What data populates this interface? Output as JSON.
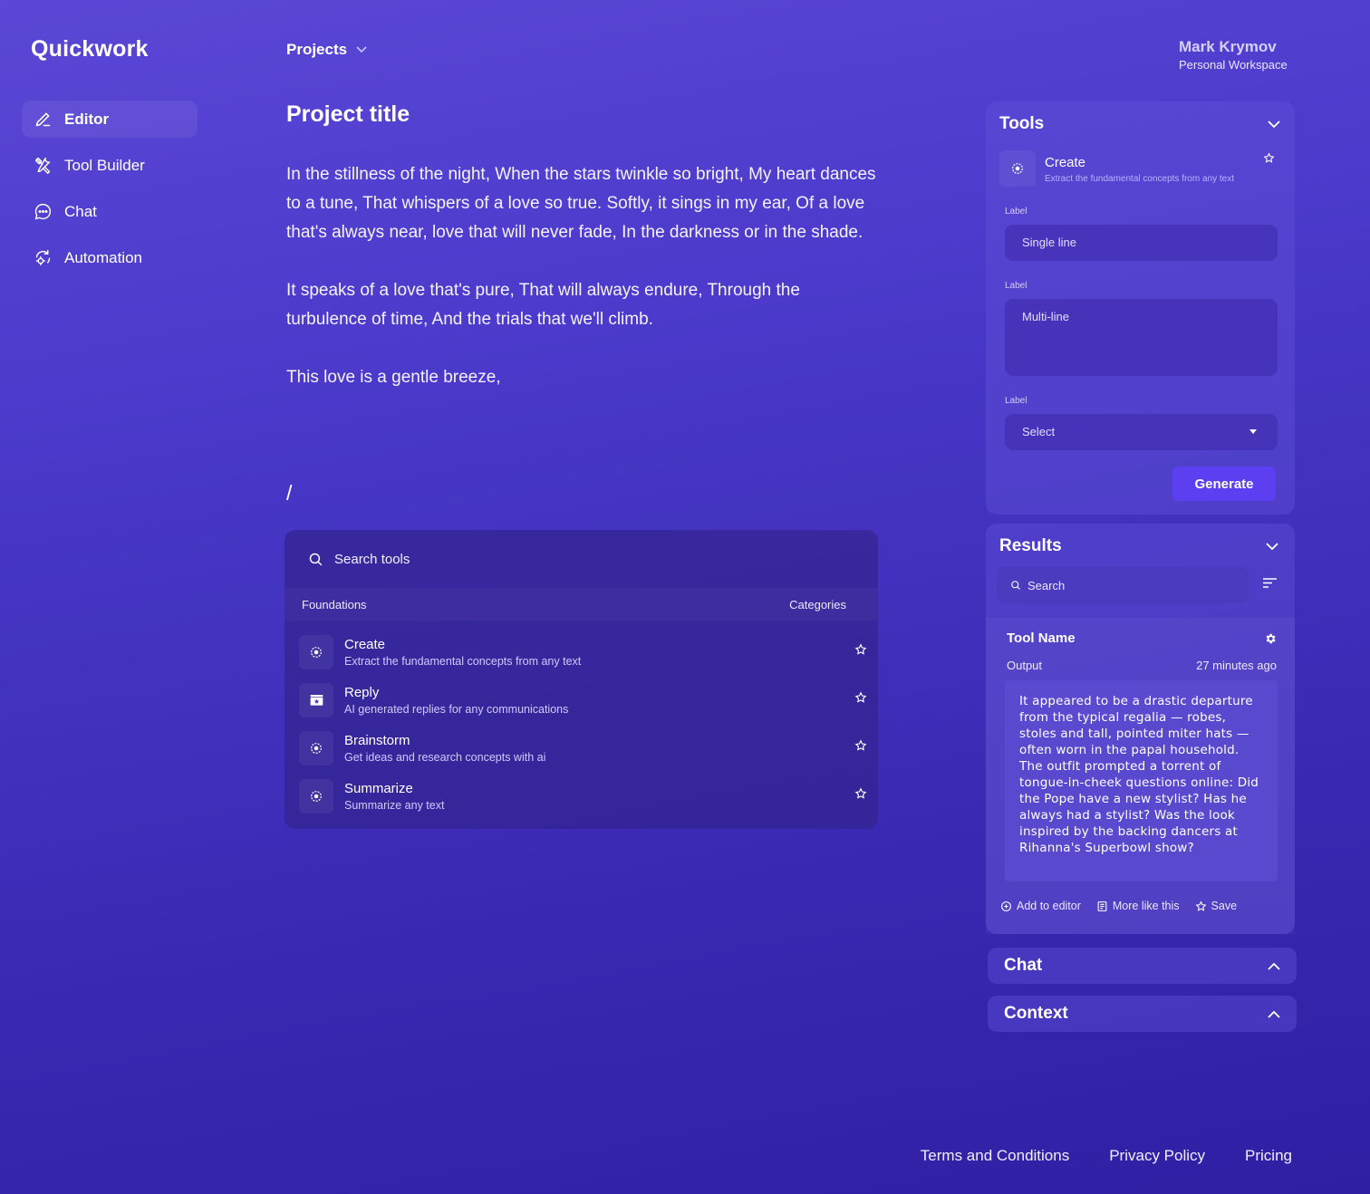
{
  "app": {
    "name": "Quickwork"
  },
  "sidebar": {
    "items": [
      {
        "label": "Editor",
        "icon": "pencil-icon",
        "active": true
      },
      {
        "label": "Tool Builder",
        "icon": "tools-icon"
      },
      {
        "label": "Chat",
        "icon": "chat-bubble-icon"
      },
      {
        "label": "Automation",
        "icon": "automation-icon"
      }
    ]
  },
  "header": {
    "projects_label": "Projects",
    "user_name": "Mark Krymov",
    "workspace": "Personal Workspace"
  },
  "editor": {
    "title": "Project title",
    "paragraphs": [
      "In the stillness of the night,  When the stars twinkle so bright,  My heart dances to a tune, That whispers of a love so true. Softly, it sings in my ear,  Of a love that's always near, love that will never fade,  In the darkness or in the shade.",
      "It speaks of a love that's pure,  That will always endure,  Through the turbulence of time,  And the trials that we'll climb.",
      "This love is a gentle breeze,"
    ],
    "slash": "/"
  },
  "tool_menu": {
    "search_placeholder": "Search tools",
    "section": "Foundations",
    "categories": "Categories",
    "items": [
      {
        "title": "Create",
        "desc": "Extract the fundamental concepts from any text",
        "icon": "sparkle-icon"
      },
      {
        "title": "Reply",
        "desc": "AI generated replies for any communications",
        "icon": "clapper-icon"
      },
      {
        "title": "Brainstorm",
        "desc": "Get ideas and research concepts with ai",
        "icon": "sparkle-icon"
      },
      {
        "title": "Summarize",
        "desc": "Summarize any text",
        "icon": "sparkle-icon"
      }
    ]
  },
  "tools_panel": {
    "title": "Tools",
    "card": {
      "title": "Create",
      "desc": "Extract the fundamental concepts from any text"
    },
    "fields": [
      {
        "label": "Label",
        "placeholder": "Single line"
      },
      {
        "label": "Label",
        "placeholder": "Multi-line"
      },
      {
        "label": "Label",
        "value": "Select"
      }
    ],
    "generate": "Generate"
  },
  "results_panel": {
    "title": "Results",
    "search_placeholder": "Search",
    "tool_name": "Tool Name",
    "output_label": "Output",
    "time": "27 minutes ago",
    "output_text": "It appeared to be a drastic departure from the typical regalia — robes, stoles and tall, pointed miter hats — often worn in the papal household. The outfit prompted a torrent of tongue-in-cheek questions online: Did the Pope have a new stylist? Has he always had a stylist? Was the look inspired by the backing dancers at Rihanna's Superbowl show?",
    "actions": [
      "Add to editor",
      "More like this",
      "Save"
    ]
  },
  "collapsed_panels": [
    "Chat",
    "Context"
  ],
  "footer": [
    "Terms and Conditions",
    "Privacy Policy",
    "Pricing"
  ],
  "colors": {
    "accent": "#5b3ff0",
    "background_top": "#5a47d6",
    "background_bottom": "#2f1fa3"
  }
}
